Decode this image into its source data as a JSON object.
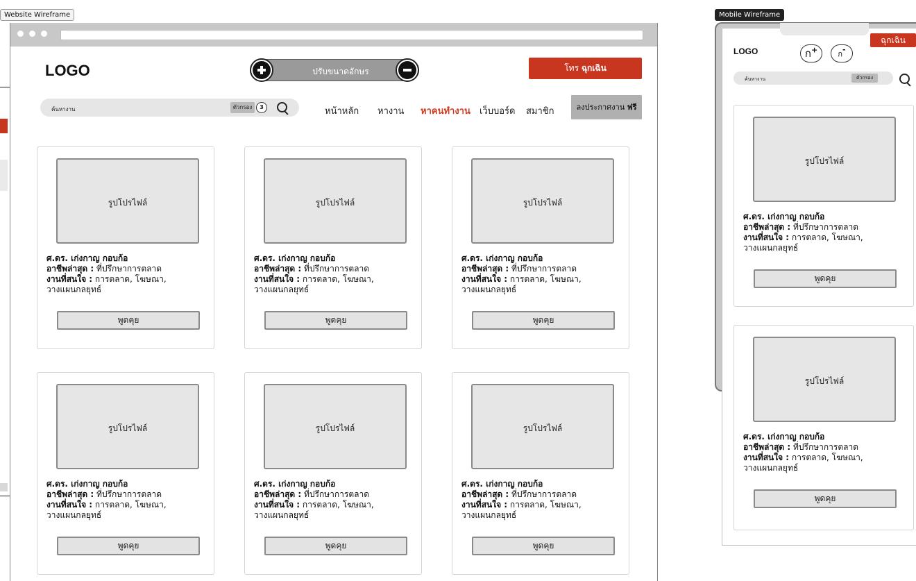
{
  "labels": {
    "website": "Website Wireframe",
    "mobile": "Mobile Wireframe"
  },
  "desktop": {
    "logo": "LOGO",
    "font_control": {
      "label": "ปรับขนาดอักษร",
      "increase_icon": "plus-icon",
      "decrease_icon": "minus-icon"
    },
    "emergency": {
      "prefix": "โทร",
      "highlight": "ฉุกเฉิน"
    },
    "search": {
      "placeholder": "ค้นหางาน",
      "filter_label": "ตัวกรอง",
      "filter_count": "3",
      "icon": "search-icon"
    },
    "nav": [
      "หน้าหลัก",
      "หางาน",
      "หาคนทำงาน",
      "เว็บบอร์ด",
      "สมาชิก"
    ],
    "active_nav": "หาคนทำงาน",
    "post_job": {
      "prefix": "ลงประกาศงาน",
      "highlight": "ฟรี"
    }
  },
  "card": {
    "photo": "รูปโปรไฟล์",
    "name": "ศ.ดร. เก่งกาญ กอบก้อ",
    "job_label": "อาชีพล่าสุด :",
    "job_value": " ที่ปรึกษาการตลาด",
    "interest_label": "งานที่สนใจ :",
    "interest_value": " การตลาด, โฆษณา,",
    "interest_value2": "วางแผนกลยุทธ์",
    "button": "พูดคุย"
  },
  "mobile": {
    "emergency": "ฉุกเฉิน",
    "logo": "LOGO",
    "font_increase": "ก",
    "font_increase_sign": "+",
    "font_decrease": "ก",
    "font_decrease_sign": "-",
    "search_placeholder": "ค้นหางาน",
    "filter_label": "ตัวกรอง"
  }
}
